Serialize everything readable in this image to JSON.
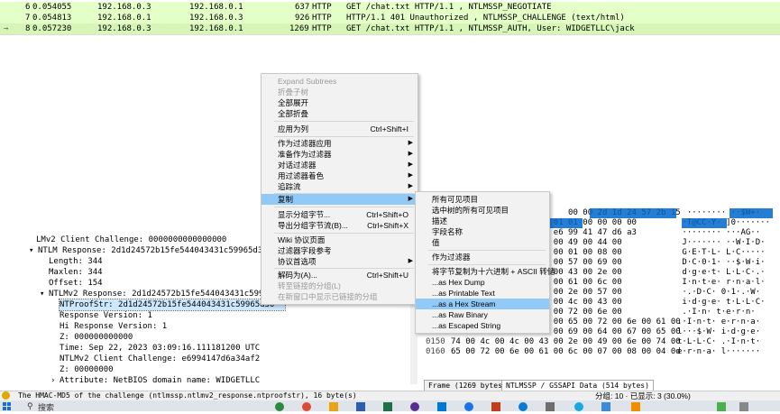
{
  "packets": [
    {
      "no": "6",
      "time": "0.054055",
      "src": "192.168.0.3",
      "dst": "192.168.0.1",
      "len": "637",
      "proto": "HTTP",
      "info": "GET /chat.txt HTTP/1.1 , NTLMSSP_NEGOTIATE"
    },
    {
      "no": "7",
      "time": "0.054813",
      "src": "192.168.0.1",
      "dst": "192.168.0.3",
      "len": "926",
      "proto": "HTTP",
      "info": "HTTP/1.1 401 Unauthorized , NTLMSSP_CHALLENGE (text/html)"
    },
    {
      "no": "8",
      "time": "0.057230",
      "src": "192.168.0.3",
      "dst": "192.168.0.1",
      "len": "1269",
      "proto": "HTTP",
      "info": "GET /chat.txt HTTP/1.1 , NTLMSSP_AUTH, User: WIDGETLLC\\jack"
    }
  ],
  "detail": [
    "LMv2 Client Challenge: 0000000000000000",
    "NTLM Response: 2d1d24572b15fe544043431c59965d30010",
    "Length: 344",
    "Maxlen: 344",
    "Offset: 154",
    "NTLMv2 Response: 2d1d24572b15fe544043431c59965d3",
    "NTProofStr: 2d1d24572b15fe544043431c59965d30",
    "Response Version: 1",
    "Hi Response Version: 1",
    "Z: 000000000000",
    "Time: Sep 22, 2023 03:09:16.111181200 UTC",
    "NTLMv2 Client Challenge: e6994147d6a34af2",
    "Z: 00000000",
    "Attribute: NetBIOS domain name: WIDGETLLC"
  ],
  "hex": [
    {
      "off": "",
      "bytes": "                        00 00 2d 1d 24 57 2b 15",
      "ascii": "  ········ ··$W+·"
    },
    {
      "off": "",
      "bytes": "            96 5d 30 01 01 00 00 00 00",
      "ascii": " ·T@CC·Y· ]0·······"
    },
    {
      "off": "",
      "bytes": "            ed d9 01 e6 99 41 47 d6 a3",
      "ascii": " ········ ···AG··"
    },
    {
      "off": "",
      "bytes": "            12 00 57 00 49 00 44 00",
      "ascii": " J······· ··W·I·D·"
    },
    {
      "off": "",
      "bytes": "            4c 00 43 00 01 00 08 00",
      "ascii": " G·E·T·L· L·C·····"
    },
    {
      "off": "",
      "bytes": "            04 00 24 00 57 00 69 00",
      "ascii": " D·C·0·1· ··$·W·i·"
    },
    {
      "off": "",
      "bytes": "            4c 00 4c 00 43 00 2e 00",
      "ascii": " d·g·e·t· L·L·C·.·"
    },
    {
      "off": "",
      "bytes": "            72 00 6e 00 61 00 6c 00",
      "ascii": " I·n·t·e· r·n·a·l·"
    },
    {
      "off": "",
      "bytes": "            30 00 31 00 2e 00 57 00",
      "ascii": " ·.·D·C· 0·1·.·W·"
    },
    {
      "off": "",
      "bytes": "            74 00 4c 00 4c 00 43 00",
      "ascii": " i·d·g·e· t·L·L·C·"
    },
    {
      "off": "",
      "bytes": "            74 00 65 00 72 00 6e 00",
      "ascii": " .·I·n· t·e·r·n·"
    },
    {
      "off": "0130",
      "bytes": "2e 00 49 00 6e 00 74 00 65 00 72 00 6e 00 61 00",
      "ascii": ".·I·n·t· e·r·n·a·"
    },
    {
      "off": "0140",
      "bytes": "6c 00 05 00 24 00 57 00 69 00 64 00 67 00 65 00",
      "ascii": "l···$·W· i·d·g·e·"
    },
    {
      "off": "0150",
      "bytes": "74 00 4c 00 4c 00 43 00 2e 00 49 00 6e 00 74 00",
      "ascii": "t·L·L·C· .·I·n·t·"
    },
    {
      "off": "0160",
      "bytes": "65 00 72 00 6e 00 61 00 6c 00 07 00 08 00 04 0d",
      "ascii": "e·r·n·a· l·······"
    }
  ],
  "tabs": [
    "Frame (1269 bytes)",
    "NTLMSSP / GSSAPI Data (514 bytes)"
  ],
  "status": {
    "field": "The HMAC-MD5 of the challenge (ntlmssp.ntlmv2_response.ntproofstr), 16 byte(s)",
    "right": "分组: 10 · 已显示: 3 (30.0%)"
  },
  "context_menu": [
    {
      "label": "Expand Subtrees",
      "disabled": true
    },
    {
      "label": "折叠子树",
      "disabled": true
    },
    {
      "label": "全部展开"
    },
    {
      "label": "全部折叠"
    },
    {
      "sep": true
    },
    {
      "label": "应用为列",
      "shortcut": "Ctrl+Shift+I"
    },
    {
      "sep": true
    },
    {
      "label": "作为过滤器应用",
      "arrow": true
    },
    {
      "label": "准备作为过滤器",
      "arrow": true
    },
    {
      "label": "对话过滤器",
      "arrow": true
    },
    {
      "label": "用过滤器着色",
      "arrow": true
    },
    {
      "label": "追踪流",
      "arrow": true
    },
    {
      "sep": true
    },
    {
      "label": "复制",
      "arrow": true,
      "hover": true
    },
    {
      "sep": true
    },
    {
      "label": "显示分组字节...",
      "shortcut": "Ctrl+Shift+O"
    },
    {
      "label": "导出分组字节流(B)...",
      "shortcut": "Ctrl+Shift+X"
    },
    {
      "sep": true
    },
    {
      "label": "Wiki 协议页面"
    },
    {
      "label": "过滤器字段参考"
    },
    {
      "label": "协议首选项",
      "arrow": true
    },
    {
      "sep": true
    },
    {
      "label": "解码为(A)...",
      "shortcut": "Ctrl+Shift+U"
    },
    {
      "label": "转至链接的分组(L)",
      "disabled": true
    },
    {
      "label": "在新窗口中显示已链接的分组",
      "disabled": true
    }
  ],
  "submenu": [
    {
      "label": "所有可见项目"
    },
    {
      "label": "选中树的所有可见项目"
    },
    {
      "label": "描述"
    },
    {
      "label": "字段名称"
    },
    {
      "label": "值"
    },
    {
      "sep": true
    },
    {
      "label": "作为过滤器"
    },
    {
      "sep": true
    },
    {
      "label": "将字节复制为十六进制 + ASCII 转储"
    },
    {
      "label": "...as Hex Dump"
    },
    {
      "label": "...as Printable Text"
    },
    {
      "label": "...as a Hex Stream",
      "hover": true
    },
    {
      "label": "...as Raw Binary"
    },
    {
      "label": "...as Escaped String"
    }
  ],
  "taskbar": {
    "search_placeholder": "搜索"
  },
  "colors": {
    "packet_bg": "#e4ffc7",
    "hex_highlight": "#0066cc",
    "menu_hover": "#91c9f7"
  }
}
